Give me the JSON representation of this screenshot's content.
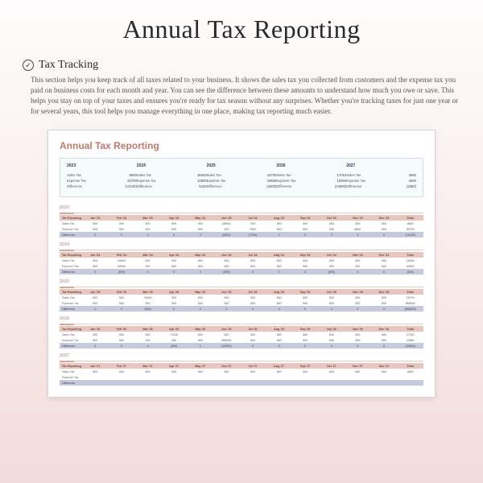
{
  "title": "Annual Tax Reporting",
  "section": {
    "icon": "check",
    "heading": "Tax Tracking",
    "intro": "This section helps you keep track of all taxes related to your business. It shows the sales tax you collected from customers and the expense tax you paid on business costs for each month and year. You can see the difference between these amounts to understand how much you owe or save. This helps you stay on top of your taxes and ensures you're ready for tax season without any surprises. Whether you're tracking taxes for just one year or for several years, this tool helps you manage everything in one place, making tax reporting much easier."
  },
  "template": {
    "title": "Annual Tax Reporting",
    "summary_rows": [
      "Sales Tax",
      "Expense Tax",
      "Difference"
    ],
    "summary": [
      {
        "year": "2023",
        "sales": "6500",
        "expense": "20700",
        "diff": "(14100)"
      },
      {
        "year": "2024",
        "sales": "15630",
        "expense": "10800",
        "diff": "5220"
      },
      {
        "year": "2025",
        "sales": "16700",
        "expense": "16650",
        "diff": "(4500)"
      },
      {
        "year": "2026",
        "sales": "17010",
        "expense": "19650",
        "diff": "(24500)"
      },
      {
        "year": "2027",
        "sales": "4650",
        "expense": "4650",
        "diff": "(2550)"
      }
    ],
    "months_header": "Tax Reporting",
    "row_labels": [
      "Sales Tax",
      "Expense Tax",
      "Difference"
    ],
    "years": [
      {
        "year": "2023",
        "months": [
          "Jan '23",
          "Feb '23",
          "Mar '23",
          "Apr '23",
          "May '23",
          "Jun '23",
          "Jul '23",
          "Aug '23",
          "Sep '23",
          "Oct '23",
          "Nov '23",
          "Dec '23",
          "Total"
        ],
        "sales": [
          "500",
          "500",
          "500",
          "500",
          "500",
          "(8500)",
          "500",
          "500",
          "500",
          "500",
          "500",
          "500",
          "6500"
        ],
        "expense": [
          "500",
          "500",
          "500",
          "500",
          "500",
          "500",
          "7600",
          "500",
          "500",
          "500",
          "6600",
          "500",
          "20700"
        ],
        "diff": [
          "0",
          "0",
          "0",
          "0",
          "0",
          "(8500)",
          "(7100)",
          "0",
          "0",
          "0",
          "0",
          "0",
          "(14100)"
        ]
      },
      {
        "year": "2024",
        "months": [
          "Jan '24",
          "Feb '24",
          "Mar '24",
          "Apr '24",
          "May '24",
          "Jun '24",
          "Jul '24",
          "Aug '24",
          "Sep '24",
          "Oct '24",
          "Nov '24",
          "Dec '24",
          "Total"
        ],
        "sales": [
          "500",
          "15630",
          "500",
          "500",
          "500",
          "500",
          "500",
          "500",
          "500",
          "500",
          "500",
          "500",
          "15630"
        ],
        "expense": [
          "500",
          "49500",
          "500",
          "500",
          "500",
          "500",
          "500",
          "500",
          "500",
          "500",
          "500",
          "500",
          "49500"
        ],
        "diff": [
          "0",
          "(500)",
          "0",
          "0",
          "0",
          "(500)",
          "0",
          "0",
          "0",
          "(500)",
          "0",
          "0",
          "(500)"
        ]
      },
      {
        "year": "2025",
        "months": [
          "Jan '25",
          "Feb '25",
          "Mar '25",
          "Apr '25",
          "May '25",
          "Jun '25",
          "Jul '25",
          "Aug '25",
          "Sep '25",
          "Oct '25",
          "Nov '25",
          "Dec '25",
          "Total"
        ],
        "sales": [
          "500",
          "500",
          "74500",
          "500",
          "500",
          "500",
          "500",
          "500",
          "500",
          "500",
          "500",
          "500",
          "16700"
        ],
        "expense": [
          "500",
          "500",
          "500",
          "500",
          "500",
          "500",
          "500",
          "500",
          "500",
          "500",
          "500",
          "500",
          "858000"
        ],
        "diff": [
          "0",
          "0",
          "(500)",
          "0",
          "0",
          "0",
          "0",
          "0",
          "0",
          "0",
          "0",
          "0",
          "(858000)"
        ]
      },
      {
        "year": "2026",
        "months": [
          "Jan '26",
          "Feb '26",
          "Mar '26",
          "Apr '26",
          "May '26",
          "Jun '26",
          "Jul '26",
          "Aug '26",
          "Sep '26",
          "Oct '26",
          "Nov '26",
          "Dec '26",
          "Total"
        ],
        "sales": [
          "500",
          "500",
          "500",
          "71010",
          "500",
          "500",
          "500",
          "500",
          "500",
          "500",
          "500",
          "500",
          "17010"
        ],
        "expense": [
          "500",
          "500",
          "500",
          "500",
          "500",
          "858000",
          "500",
          "500",
          "500",
          "500",
          "500",
          "500",
          "19650"
        ],
        "diff": [
          "0",
          "0",
          "0",
          "(500)",
          "0",
          "(24500)",
          "0",
          "0",
          "0",
          "0",
          "0",
          "0",
          "(24500)"
        ]
      },
      {
        "year": "2027",
        "months": [
          "Jan '27",
          "Feb '27",
          "Mar '27",
          "Apr '27",
          "May '27",
          "Jun '27",
          "Jul '27",
          "Aug '27",
          "Sep '27",
          "Oct '27",
          "Nov '27",
          "Dec '27",
          "Total"
        ],
        "sales": [
          "500",
          "500",
          "500",
          "500",
          "500",
          "500",
          "500",
          "500",
          "500",
          "500",
          "500",
          "500",
          "4650"
        ],
        "expense": [
          "",
          "",
          "",
          "",
          "",
          "",
          "",
          "",
          "",
          "",
          "",
          "",
          ""
        ],
        "diff": [
          "",
          "",
          "",
          "",
          "",
          "",
          "",
          "",
          "",
          "",
          "",
          "",
          ""
        ]
      }
    ]
  }
}
